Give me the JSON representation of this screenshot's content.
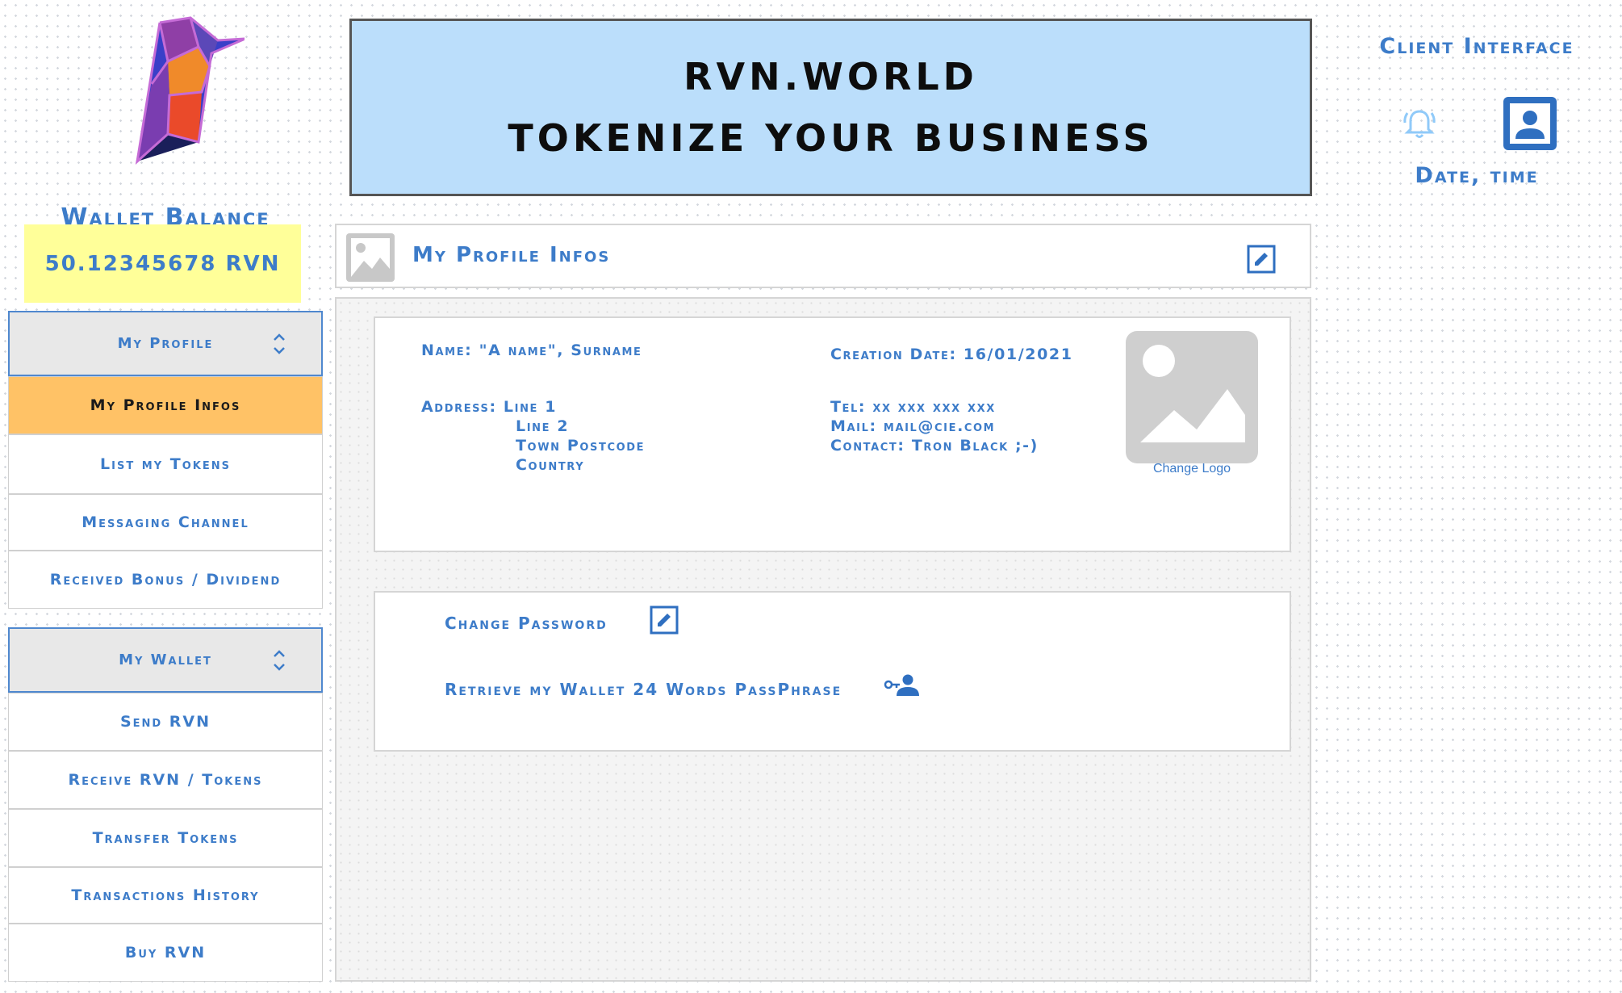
{
  "header": {
    "banner_line1": "RVN.WORLD",
    "banner_line2": "TOKENIZE YOUR BUSINESS",
    "client_interface": "Client Interface",
    "datetime": "Date, time",
    "icons": [
      "bell-icon",
      "contact-icon"
    ]
  },
  "wallet": {
    "title": "Wallet Balance",
    "balance": "50.12345678 RVN"
  },
  "sidebar": {
    "profile_section": {
      "label": "My Profile",
      "items": [
        {
          "label": "My Profile Infos",
          "active": true
        },
        {
          "label": "List my Tokens",
          "active": false
        },
        {
          "label": "Messaging Channel",
          "active": false
        },
        {
          "label": "Received Bonus / Dividend",
          "active": false
        }
      ]
    },
    "wallet_section": {
      "label": "My Wallet",
      "items": [
        {
          "label": "Send RVN"
        },
        {
          "label": "Receive RVN / Tokens"
        },
        {
          "label": "Transfer Tokens"
        },
        {
          "label": "Transactions History"
        },
        {
          "label": "Buy RVN"
        }
      ]
    }
  },
  "profile": {
    "title": "My Profile Infos",
    "name": "Name: \"A name\", Surname",
    "address_line1": "Address: Line 1",
    "address_line2": "Line 2",
    "address_line3": "Town Postcode",
    "address_line4": "Country",
    "creation_date": "Creation Date: 16/01/2021",
    "tel": "Tel: xx xxx xxx xxx",
    "mail": "Mail: mail@cie.com",
    "contact": "Contact: Tron Black ;-)",
    "change_logo": "Change Logo"
  },
  "security": {
    "change_password": "Change Password",
    "retrieve_passphrase": "Retrieve my Wallet 24 Words PassPhrase"
  },
  "colors": {
    "accent_blue": "#3d7cc9",
    "banner_bg": "#bbdefb",
    "balance_bg": "#ffff99",
    "active_item_bg": "#ffc266"
  }
}
